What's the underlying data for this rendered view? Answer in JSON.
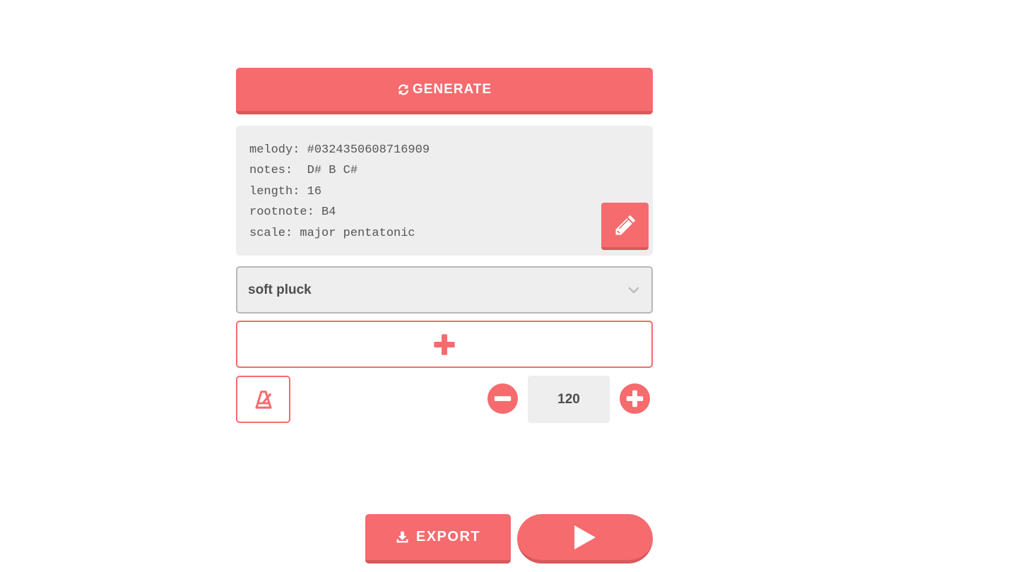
{
  "theme": {
    "accent": "#f56b6e",
    "accent_dark": "#d9595c",
    "panel_bg": "#eeeeee",
    "text": "#555555"
  },
  "generate": {
    "label": "GENERATE",
    "icon": "refresh-icon"
  },
  "melody_info": {
    "lines": [
      "melody: #0324350608716909",
      "notes:  D# B C#",
      "length: 16",
      "rootnote: B4",
      "scale: major pentatonic"
    ],
    "edit_icon": "pencil-icon"
  },
  "instrument": {
    "selected": "soft pluck",
    "icon": "chevron-down-icon"
  },
  "add_track": {
    "icon": "plus-icon"
  },
  "tempo": {
    "metronome_icon": "metronome-icon",
    "minus_icon": "minus-circle-icon",
    "plus_icon": "plus-circle-icon",
    "bpm": "120"
  },
  "export": {
    "label": "EXPORT",
    "icon": "download-icon"
  },
  "play": {
    "icon": "play-icon"
  }
}
